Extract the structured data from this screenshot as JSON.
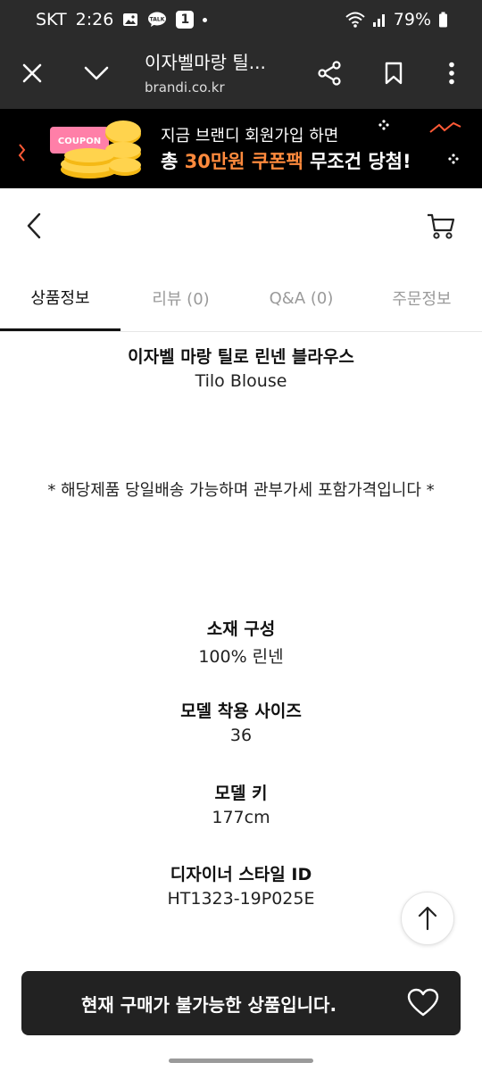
{
  "status_bar": {
    "carrier": "SKT",
    "time": "2:26",
    "notif_count": "1",
    "battery": "79%",
    "icons": [
      "gallery-icon",
      "talk-icon",
      "wifi-icon",
      "signal-icon",
      "battery-icon"
    ]
  },
  "browser": {
    "page_title": "이자벨마랑 틸...",
    "url": "brandi.co.kr",
    "icons": [
      "close-icon",
      "chevron-down-icon",
      "share-icon",
      "bookmark-icon",
      "more-vert-icon"
    ]
  },
  "promo": {
    "coupon_label": "COUPON",
    "line1": "지금 브랜디 회원가입 하면",
    "line2_prefix": "총 ",
    "line2_accent": "30만원 쿠폰팩",
    "line2_suffix": " 무조건 당첨!",
    "accent_color": "#ff8a3d"
  },
  "tabs": [
    {
      "label": "상품정보",
      "active": true
    },
    {
      "label": "리뷰 (0)",
      "active": false
    },
    {
      "label": "Q&A (0)",
      "active": false
    },
    {
      "label": "주문정보",
      "active": false
    }
  ],
  "product": {
    "name_ko": "이자벨 마랑 틸로 린넨 블라우스",
    "name_en": "Tilo Blouse",
    "note": "* 해당제품 당일배송 가능하며 관부가세 포함가격입니다 *",
    "material_label": "소재 구성",
    "material_value": "100% 린넨",
    "model_size_label": "모델 착용 사이즈",
    "model_size_value": "36",
    "model_height_label": "모델 키",
    "model_height_value": "177cm",
    "style_id_label": "디자이너 스타일 ID",
    "style_id_value": "HT1323-19P025E"
  },
  "buy_bar": {
    "label": "현재 구매가 불가능한 상품입니다."
  }
}
